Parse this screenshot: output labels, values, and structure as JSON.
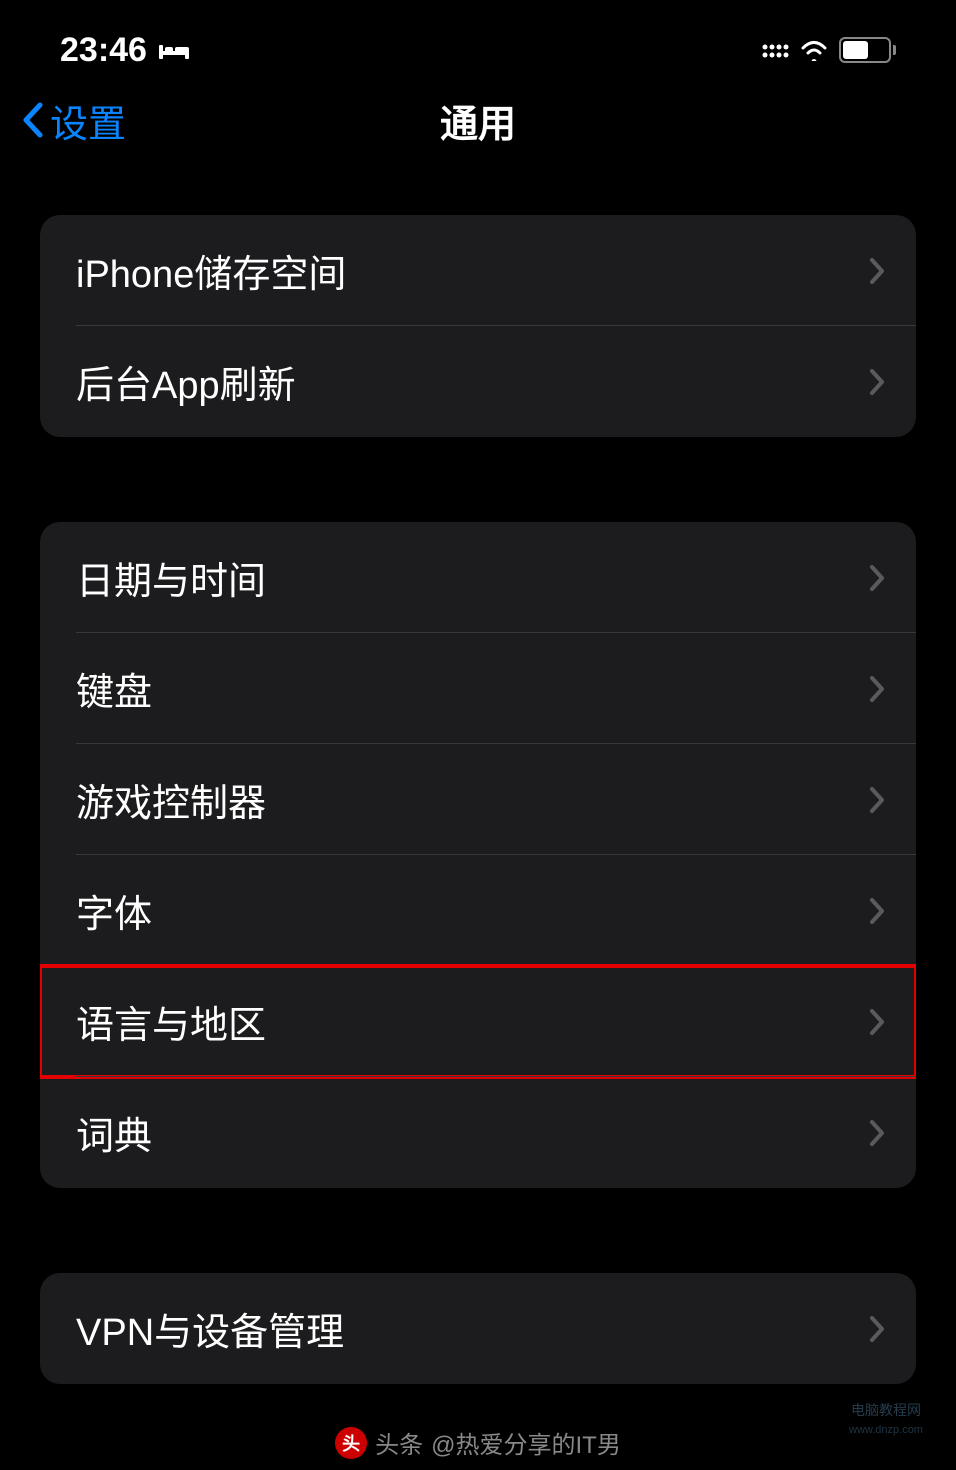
{
  "status_bar": {
    "time": "23:46",
    "battery_level": "56"
  },
  "nav": {
    "back_label": "设置",
    "title": "通用"
  },
  "groups": {
    "group1": {
      "items": [
        {
          "label": "iPhone储存空间"
        },
        {
          "label": "后台App刷新"
        }
      ]
    },
    "group2": {
      "items": [
        {
          "label": "日期与时间"
        },
        {
          "label": "键盘"
        },
        {
          "label": "游戏控制器"
        },
        {
          "label": "字体"
        },
        {
          "label": "语言与地区"
        },
        {
          "label": "词典"
        }
      ]
    },
    "group3": {
      "items": [
        {
          "label": "VPN与设备管理"
        }
      ]
    }
  },
  "footer": {
    "source_label": "头条",
    "author": "@热爱分享的IT男"
  }
}
